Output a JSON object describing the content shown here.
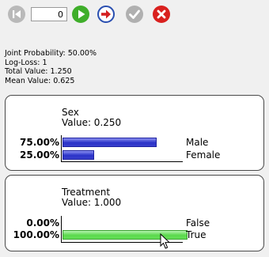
{
  "toolbar": {
    "counter_value": "0",
    "buttons": [
      {
        "name": "first-button",
        "icon": "skip-to-start-icon",
        "enabled": false
      },
      {
        "name": "play-button",
        "icon": "play-icon",
        "enabled": true
      },
      {
        "name": "next-button",
        "icon": "arrow-right-icon",
        "enabled": true
      },
      {
        "name": "check-button",
        "icon": "checkmark-icon",
        "enabled": false
      },
      {
        "name": "stop-button",
        "icon": "close-icon",
        "enabled": true
      }
    ]
  },
  "stats": {
    "joint_probability": "Joint Probability: 50.00%",
    "log_loss": "Log-Loss: 1",
    "total_value": "Total Value: 1.250",
    "mean_value": "Mean Value: 0.625"
  },
  "nodes": [
    {
      "name": "Sex",
      "value_text": "Value: 0.250",
      "states": [
        {
          "label": "Male",
          "percent_text": "75.00%",
          "fraction": 0.75
        },
        {
          "label": "Female",
          "percent_text": "25.00%",
          "fraction": 0.25
        }
      ],
      "bar_color": "#2a32c8"
    },
    {
      "name": "Treatment",
      "value_text": "Value: 1.000",
      "states": [
        {
          "label": "False",
          "percent_text": "0.00%",
          "fraction": 0.0
        },
        {
          "label": "True",
          "percent_text": "100.00%",
          "fraction": 1.0
        }
      ],
      "bar_color": "#5ad84c"
    }
  ],
  "colors": {
    "background": "#f0f0f0",
    "panel_border": "#4a4a4a",
    "play": "#3fae2a",
    "stop": "#d9201e",
    "next_arrow": "#d42020",
    "disabled": "#b9b9b9"
  }
}
